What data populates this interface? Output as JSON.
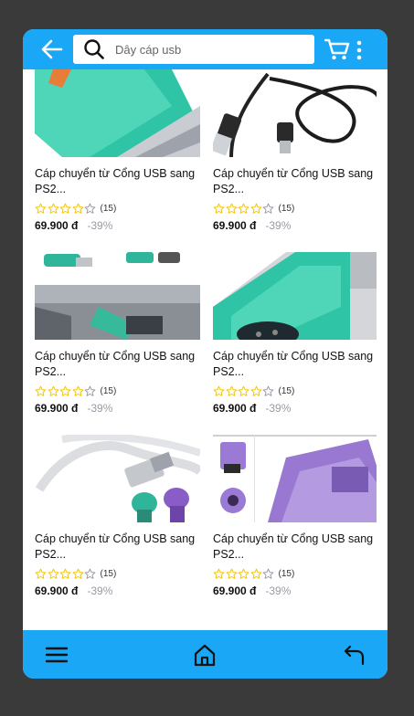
{
  "search": {
    "placeholder": "Dây cáp usb"
  },
  "icons": {
    "back": "arrow-left-icon",
    "search": "search-icon",
    "cart": "cart-icon",
    "more": "more-vertical-icon",
    "menu": "menu-icon",
    "home": "home-icon",
    "undo": "undo-icon"
  },
  "colors": {
    "accent": "#1aa7f5",
    "star": "#f5c400",
    "discount": "#9a9aa5"
  },
  "products": [
    {
      "title": "Cáp chuyển từ Cổng USB sang PS2...",
      "rating": 4,
      "reviews": "(15)",
      "price": "69.900 đ",
      "discount": "-39%"
    },
    {
      "title": "Cáp chuyển từ Cổng USB sang PS2...",
      "rating": 4,
      "reviews": "(15)",
      "price": "69.900 đ",
      "discount": "-39%"
    },
    {
      "title": "Cáp chuyển từ Cổng USB sang PS2...",
      "rating": 4,
      "reviews": "(15)",
      "price": "69.900 đ",
      "discount": "-39%"
    },
    {
      "title": "Cáp chuyển từ Cổng USB sang PS2...",
      "rating": 4,
      "reviews": "(15)",
      "price": "69.900 đ",
      "discount": "-39%"
    },
    {
      "title": "Cáp chuyển từ Cổng USB sang PS2...",
      "rating": 4,
      "reviews": "(15)",
      "price": "69.900 đ",
      "discount": "-39%"
    },
    {
      "title": "Cáp chuyển từ Cổng USB sang PS2...",
      "rating": 4,
      "reviews": "(15)",
      "price": "69.900 đ",
      "discount": "-39%"
    }
  ]
}
